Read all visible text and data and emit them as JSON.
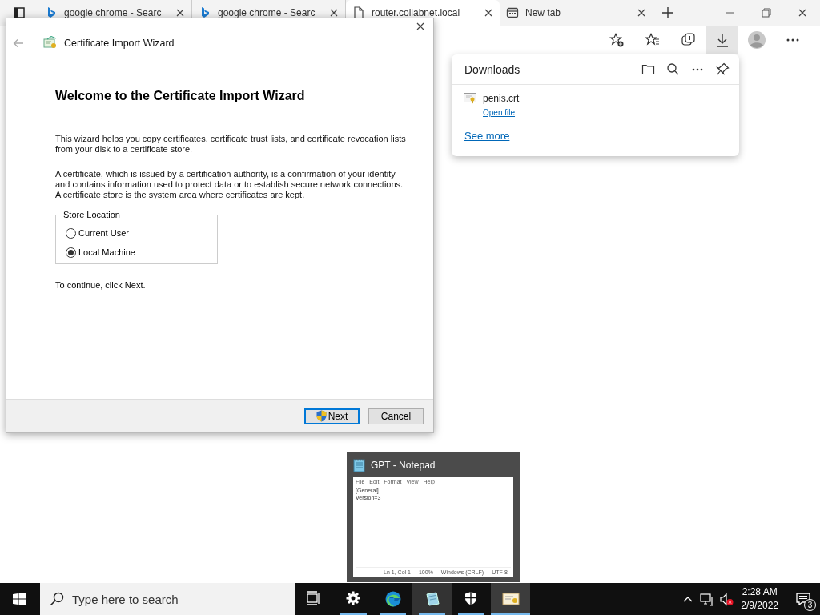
{
  "browser": {
    "tabs": [
      {
        "title": "google chrome - Searc",
        "kind": "search",
        "selected": false
      },
      {
        "title": "google chrome - Searc",
        "kind": "search",
        "selected": false
      },
      {
        "title": "router.collabnet.local",
        "kind": "page",
        "selected": true
      },
      {
        "title": "New tab",
        "kind": "newtab",
        "selected": false
      }
    ]
  },
  "downloads": {
    "title": "Downloads",
    "items": [
      {
        "filename": "penis.crt",
        "action": "Open file"
      }
    ],
    "see_more": "See more"
  },
  "dialog": {
    "title": "Certificate Import Wizard",
    "heading": "Welcome to the Certificate Import Wizard",
    "paragraphs": [
      "This wizard helps you copy certificates, certificate trust lists, and certificate revocation lists from your disk to a certificate store.",
      "A certificate, which is issued by a certification authority, is a confirmation of your identity and contains information used to protect data or to establish secure network connections. A certificate store is the system area where certificates are kept."
    ],
    "store_location": {
      "label": "Store Location",
      "options": [
        {
          "label": "Current User",
          "selected": false
        },
        {
          "label": "Local Machine",
          "selected": true
        }
      ]
    },
    "hint": "To continue, click Next.",
    "buttons": [
      {
        "label": "Next",
        "kind": "primary"
      },
      {
        "label": "Cancel",
        "kind": "default"
      }
    ]
  },
  "notepad_preview": {
    "title": "GPT - Notepad",
    "menu": [
      "File",
      "Edit",
      "Format",
      "View",
      "Help"
    ],
    "lines": [
      "[General]",
      "Version=3"
    ],
    "status": [
      "Ln 1, Col 1",
      "100%",
      "Windows (CRLF)",
      "UTF-8"
    ]
  },
  "taskbar": {
    "search_placeholder": "Type here to search",
    "apps": [
      {
        "kind": "taskview",
        "running": false,
        "hovered": false,
        "selected": false
      },
      {
        "kind": "settings",
        "running": true,
        "hovered": false,
        "selected": false
      },
      {
        "kind": "edge",
        "running": true,
        "hovered": false,
        "selected": false
      },
      {
        "kind": "notepad",
        "running": true,
        "hovered": true,
        "selected": false
      },
      {
        "kind": "security",
        "running": true,
        "hovered": false,
        "selected": false
      },
      {
        "kind": "certificate",
        "running": true,
        "hovered": false,
        "selected": true
      }
    ],
    "time": "2:28 AM",
    "date": "2/9/2022",
    "notifications": "3"
  }
}
